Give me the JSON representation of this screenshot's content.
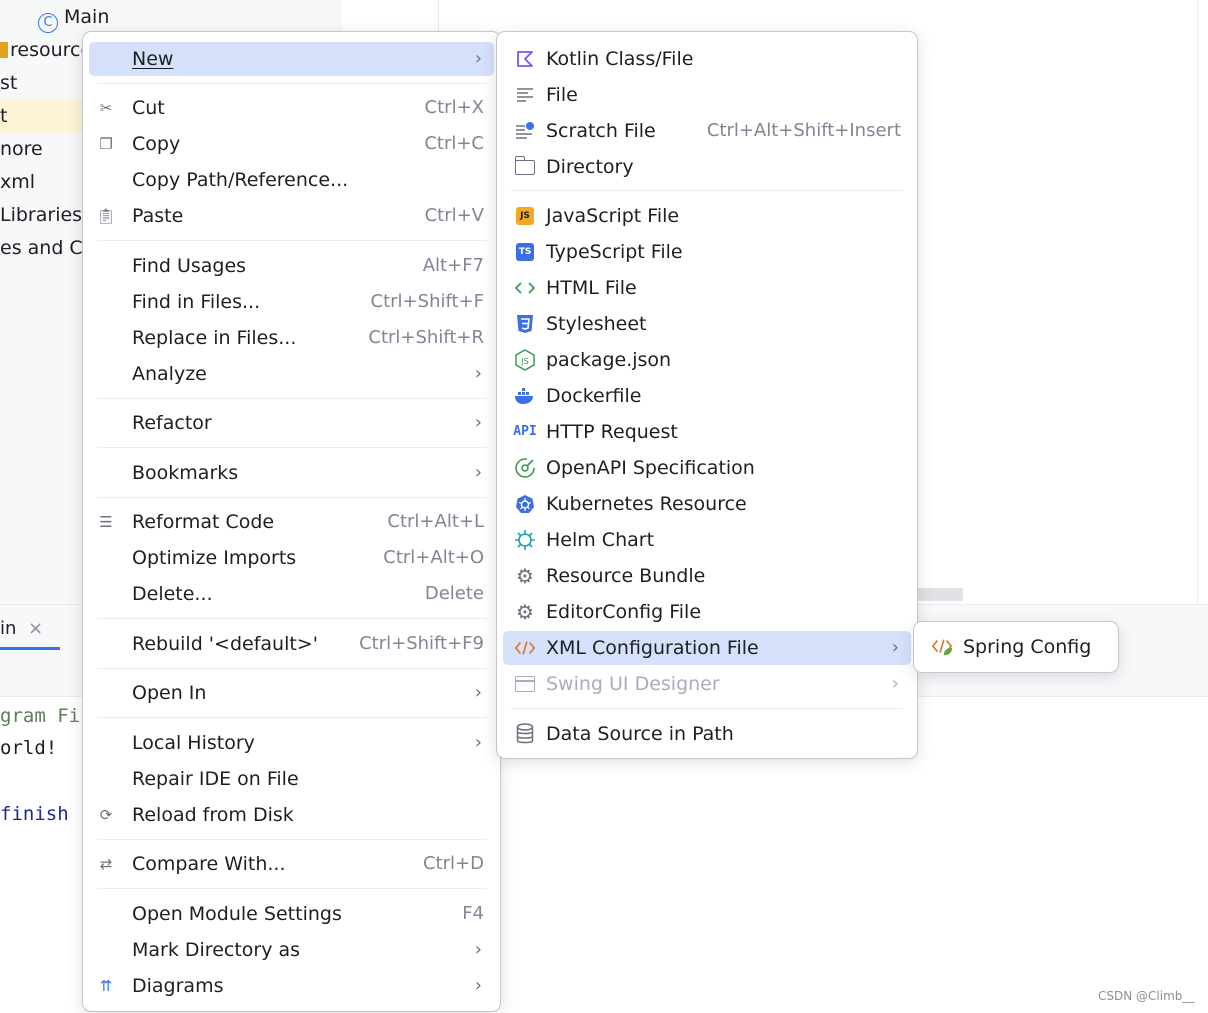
{
  "background": {
    "project_tree": [
      {
        "label": "Main",
        "icon": "class-icon"
      },
      {
        "label": "resource",
        "icon": "resources-folder-icon"
      },
      {
        "label": "st"
      },
      {
        "label": "t",
        "selected": true
      },
      {
        "label": "nore"
      },
      {
        "label": "xml"
      },
      {
        "label": " Libraries"
      },
      {
        "label": "es and Co"
      }
    ],
    "run_tab": {
      "label": "in",
      "close": "×"
    },
    "console_lines": [
      {
        "text": "gram Fi"
      },
      {
        "text": "orld!"
      },
      {
        "text": " finish"
      }
    ]
  },
  "main_menu": {
    "items": [
      {
        "label": "New",
        "arrow": "›",
        "highlight": true
      },
      {
        "label": "Cut",
        "shortcut": "Ctrl+X",
        "icon": "scissors-icon"
      },
      {
        "label": "Copy",
        "shortcut": "Ctrl+C",
        "icon": "copy-icon"
      },
      {
        "label": "Copy Path/Reference..."
      },
      {
        "label": "Paste",
        "shortcut": "Ctrl+V",
        "icon": "clipboard-icon"
      },
      {
        "label": "Find Usages",
        "shortcut": "Alt+F7"
      },
      {
        "label": "Find in Files...",
        "shortcut": "Ctrl+Shift+F"
      },
      {
        "label": "Replace in Files...",
        "shortcut": "Ctrl+Shift+R"
      },
      {
        "label": "Analyze",
        "arrow": "›"
      },
      {
        "label": "Refactor",
        "arrow": "›"
      },
      {
        "label": "Bookmarks",
        "arrow": "›"
      },
      {
        "label": "Reformat Code",
        "shortcut": "Ctrl+Alt+L",
        "icon": "reformat-icon"
      },
      {
        "label": "Optimize Imports",
        "shortcut": "Ctrl+Alt+O"
      },
      {
        "label": "Delete...",
        "shortcut": "Delete"
      },
      {
        "label": "Rebuild '<default>'",
        "shortcut": "Ctrl+Shift+F9"
      },
      {
        "label": "Open In",
        "arrow": "›"
      },
      {
        "label": "Local History",
        "arrow": "›"
      },
      {
        "label": "Repair IDE on File"
      },
      {
        "label": "Reload from Disk",
        "icon": "reload-icon"
      },
      {
        "label": "Compare With...",
        "shortcut": "Ctrl+D",
        "icon": "compare-icon"
      },
      {
        "label": "Open Module Settings",
        "shortcut": "F4"
      },
      {
        "label": "Mark Directory as",
        "arrow": "›"
      },
      {
        "label": "Diagrams",
        "arrow": "›",
        "icon": "diagram-icon"
      }
    ]
  },
  "new_menu": {
    "items": [
      {
        "label": "Kotlin Class/File",
        "icon": "kotlin-icon"
      },
      {
        "label": "File",
        "icon": "file-lines-icon"
      },
      {
        "label": "Scratch File",
        "shortcut": "Ctrl+Alt+Shift+Insert",
        "icon": "scratch-icon"
      },
      {
        "label": "Directory",
        "icon": "folder-icon"
      },
      {
        "label": "JavaScript File",
        "icon": "javascript-icon",
        "badge": "JS"
      },
      {
        "label": "TypeScript File",
        "icon": "typescript-icon",
        "badge": "TS"
      },
      {
        "label": "HTML File",
        "icon": "html-icon"
      },
      {
        "label": "Stylesheet",
        "icon": "css-icon"
      },
      {
        "label": "package.json",
        "icon": "nodejs-icon"
      },
      {
        "label": "Dockerfile",
        "icon": "docker-icon"
      },
      {
        "label": "HTTP Request",
        "icon": "api-icon",
        "badge": "API"
      },
      {
        "label": "OpenAPI Specification",
        "icon": "openapi-icon"
      },
      {
        "label": "Kubernetes Resource",
        "icon": "kubernetes-icon"
      },
      {
        "label": "Helm Chart",
        "icon": "helm-icon"
      },
      {
        "label": "Resource Bundle",
        "icon": "gear-icon"
      },
      {
        "label": "EditorConfig File",
        "icon": "gear-icon"
      },
      {
        "label": "XML Configuration File",
        "arrow": "›",
        "highlight": true,
        "icon": "xml-icon"
      },
      {
        "label": "Swing UI Designer",
        "arrow": "›",
        "disabled": true,
        "icon": "swing-icon"
      },
      {
        "label": "Data Source in Path",
        "icon": "database-icon"
      }
    ]
  },
  "xml_menu": {
    "items": [
      {
        "label": "Spring Config",
        "icon": "spring-config-icon"
      }
    ]
  },
  "watermark": "CSDN @Climb__",
  "colors": {
    "highlight": "#d5e1fb",
    "accent": "#3574f0",
    "shortcut": "#818594",
    "disabled": "#a8adbd"
  }
}
